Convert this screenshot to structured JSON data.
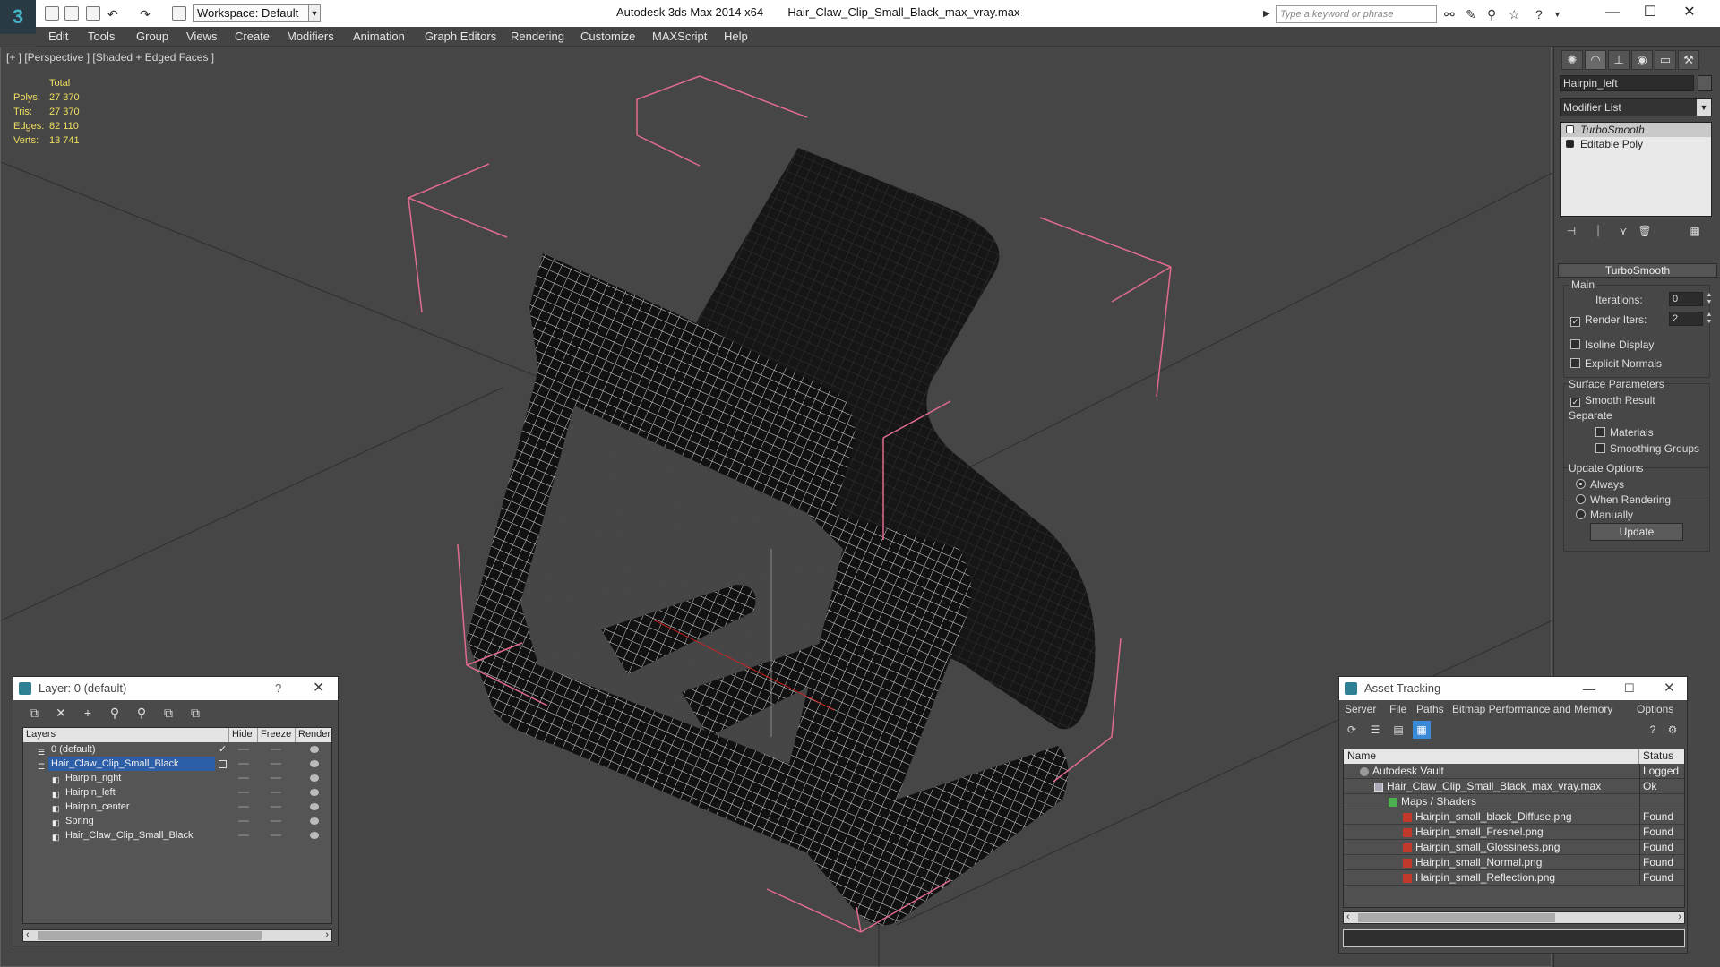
{
  "titlebar": {
    "app": "Autodesk 3ds Max  2014 x64",
    "file": "Hair_Claw_Clip_Small_Black_max_vray.max",
    "workspace": "Workspace: Default",
    "search_placeholder": "Type a keyword or phrase"
  },
  "menu": [
    "Edit",
    "Tools",
    "Group",
    "Views",
    "Create",
    "Modifiers",
    "Animation",
    "Graph Editors",
    "Rendering",
    "Customize",
    "MAXScript",
    "Help"
  ],
  "viewport": {
    "label": "[+ ] [Perspective ] [Shaded + Edged Faces ]",
    "stats": {
      "header": "Total",
      "polys_label": "Polys:",
      "polys": "27 370",
      "tris_label": "Tris:",
      "tris": "27 370",
      "edges_label": "Edges:",
      "edges": "82 110",
      "verts_label": "Verts:",
      "verts": "13 741"
    }
  },
  "command_panel": {
    "object_name": "Hairpin_left",
    "modifier_list": "Modifier List",
    "stack": [
      "TurboSmooth",
      "Editable Poly"
    ],
    "rollout": "TurboSmooth",
    "main_group": "Main",
    "iterations_label": "Iterations:",
    "iterations_value": "0",
    "render_iters_label": "Render Iters:",
    "render_iters_value": "2",
    "isoline": "Isoline Display",
    "explicit_normals": "Explicit Normals",
    "surface_group": "Surface Parameters",
    "smooth_result": "Smooth Result",
    "separate": "Separate",
    "materials": "Materials",
    "smoothing_groups": "Smoothing Groups",
    "update_group": "Update Options",
    "always": "Always",
    "when_rendering": "When Rendering",
    "manually": "Manually",
    "update_button": "Update"
  },
  "layer_window": {
    "title": "Layer: 0 (default)",
    "help": "?",
    "columns": [
      "Layers",
      "Hide",
      "Freeze",
      "Render"
    ],
    "rows": [
      {
        "name": "0 (default)"
      },
      {
        "name": "Hair_Claw_Clip_Small_Black"
      },
      {
        "name": "Hairpin_right"
      },
      {
        "name": "Hairpin_left"
      },
      {
        "name": "Hairpin_center"
      },
      {
        "name": "Spring"
      },
      {
        "name": "Hair_Claw_Clip_Small_Black"
      }
    ]
  },
  "asset_window": {
    "title": "Asset Tracking",
    "menu": [
      "Server",
      "File",
      "Paths",
      "Bitmap Performance and Memory",
      "Options"
    ],
    "columns": [
      "Name",
      "Status"
    ],
    "rows": [
      {
        "name": "Autodesk Vault",
        "status": "Logged"
      },
      {
        "name": "Hair_Claw_Clip_Small_Black_max_vray.max",
        "status": "Ok"
      },
      {
        "name": "Maps / Shaders",
        "status": ""
      },
      {
        "name": "Hairpin_small_black_Diffuse.png",
        "status": "Found"
      },
      {
        "name": "Hairpin_small_Fresnel.png",
        "status": "Found"
      },
      {
        "name": "Hairpin_small_Glossiness.png",
        "status": "Found"
      },
      {
        "name": "Hairpin_small_Normal.png",
        "status": "Found"
      },
      {
        "name": "Hairpin_small_Reflection.png",
        "status": "Found"
      }
    ]
  }
}
